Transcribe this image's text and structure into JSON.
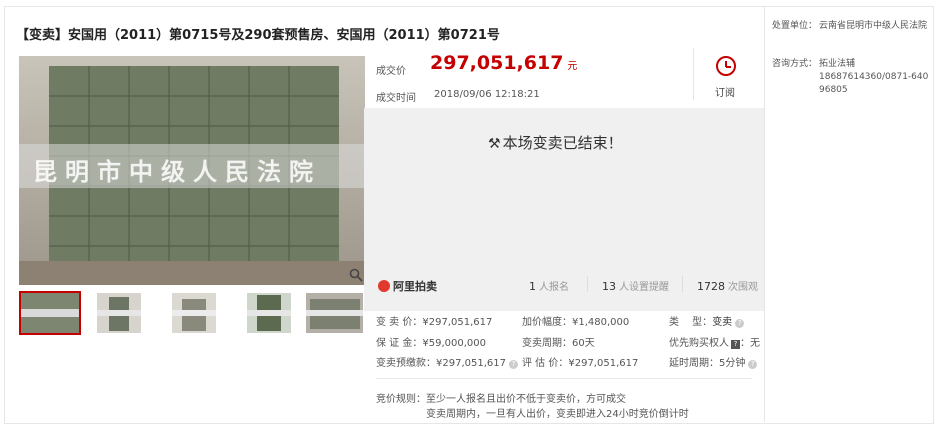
{
  "title": "【变卖】安国用（2011）第0715号及290套预售房、安国用（2011）第0721号",
  "image": {
    "watermark": "昆明市中级人民法院",
    "zoom_icon": "magnifier-icon",
    "thumbnail_count": 5
  },
  "price": {
    "label": "成交价",
    "value": "297,051,617",
    "unit": "元"
  },
  "deal_time": {
    "label": "成交时间",
    "value": "2018/09/06 12:18:21"
  },
  "subscribe": {
    "icon": "alarm-clock-icon",
    "label": "订阅"
  },
  "status": {
    "icon": "gavel-icon",
    "text": "本场变卖已结束！"
  },
  "stats": {
    "brand": "阿里拍卖",
    "registrations": {
      "count": "1",
      "label": "人报名"
    },
    "reminders": {
      "count": "13",
      "label": "人设置提醒"
    },
    "views": {
      "count": "1728",
      "label": "次围观"
    }
  },
  "details": {
    "sale_price": "变 卖 价：¥297,051,617",
    "increment": "加价幅度：¥1,480,000",
    "type_label": "类　 型：",
    "type_value": "变卖",
    "deposit": "保 证 金：¥59,000,000",
    "period": "变卖周期：60天",
    "priority_label": "优先购买权人",
    "priority_value": "：无",
    "prepay": "变卖预缴款：¥297,051,617",
    "appraisal": "评 估 价：¥297,051,617",
    "delay": "延时周期：5分钟"
  },
  "rules": {
    "label": "竞价规则：",
    "line1": "至少一人报名且出价不低于变卖价，方可成交",
    "line2": "变卖周期内，一旦有人出价，变卖即进入24小时竞价倒计时"
  },
  "sidebar": {
    "unit_label": "处置单位：",
    "unit_value": "云南省昆明市中级人民法院",
    "contact_label": "咨询方式：",
    "contact_name": "拓业法辅",
    "contact_phone": "18687614360/0871-64096805"
  },
  "colors": {
    "accent": "#c40000",
    "status_bg": "#f0f0f0"
  }
}
